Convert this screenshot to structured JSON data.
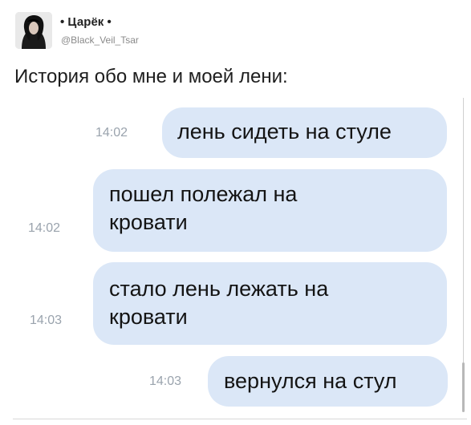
{
  "tweet": {
    "display_name": "• Царёк •",
    "handle": "@Black_Veil_Tsar",
    "text": "История обо мне и моей лени:"
  },
  "chat": {
    "messages": [
      {
        "time": "14:02",
        "lines": [
          "лень сидеть на стуле"
        ]
      },
      {
        "time": "14:02",
        "lines": [
          "пошел полежал на",
          "кровати"
        ]
      },
      {
        "time": "14:03",
        "lines": [
          "стало лень лежать на",
          "кровати"
        ]
      },
      {
        "time": "14:03",
        "lines": [
          "вернулся на стул"
        ]
      }
    ],
    "bubble_color": "#dbe7f7",
    "time_color": "#9aa3ad"
  }
}
